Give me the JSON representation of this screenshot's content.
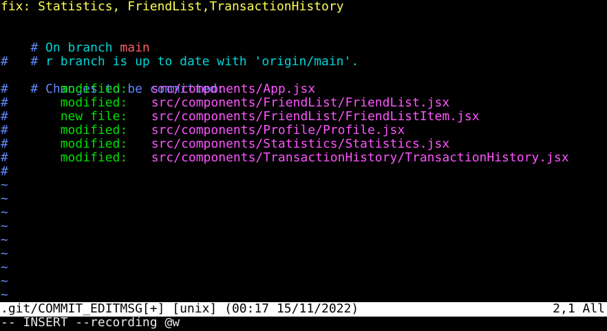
{
  "colors": {
    "background": "#000000",
    "summary": "#ffff55",
    "comment_hash": "#5f87ff",
    "branch_text": "#00d7d7",
    "branch_name": "#ff5f5f",
    "file_status": "#00e000",
    "file_path": "#ff55ff",
    "tilde": "#6b8cff",
    "statusbar_bg": "#ffffff"
  },
  "editor": {
    "summary_line": "fix: Statistics, FriendList,TransactionHistory",
    "branch": {
      "prefix": "# ",
      "text": "On branch ",
      "name": "main"
    },
    "upstream": {
      "prefix": "# ",
      "text": "r branch is up to date with 'origin/main'."
    },
    "hash": "#",
    "changes_header": {
      "prefix": "# ",
      "text": "Changes to be committed:"
    },
    "changes": [
      {
        "status": "modified:",
        "path": "src/components/App.jsx"
      },
      {
        "status": "modified:",
        "path": "src/components/FriendList/FriendList.jsx"
      },
      {
        "status": "new file:",
        "path": "src/components/FriendList/FriendListItem.jsx"
      },
      {
        "status": "modified:",
        "path": "src/components/Profile/Profile.jsx"
      },
      {
        "status": "modified:",
        "path": "src/components/Statistics/Statistics.jsx"
      },
      {
        "status": "modified:",
        "path": "src/components/TransactionHistory/TransactionHistory.jsx"
      }
    ],
    "empty_line_marker": "~"
  },
  "statusbar": {
    "file": ".git/COMMIT_EDITMSG[+] [unix] (00:17 15/11/2022)",
    "position": "2,1 All"
  },
  "cmdline": {
    "text": "-- INSERT --recording @w"
  }
}
